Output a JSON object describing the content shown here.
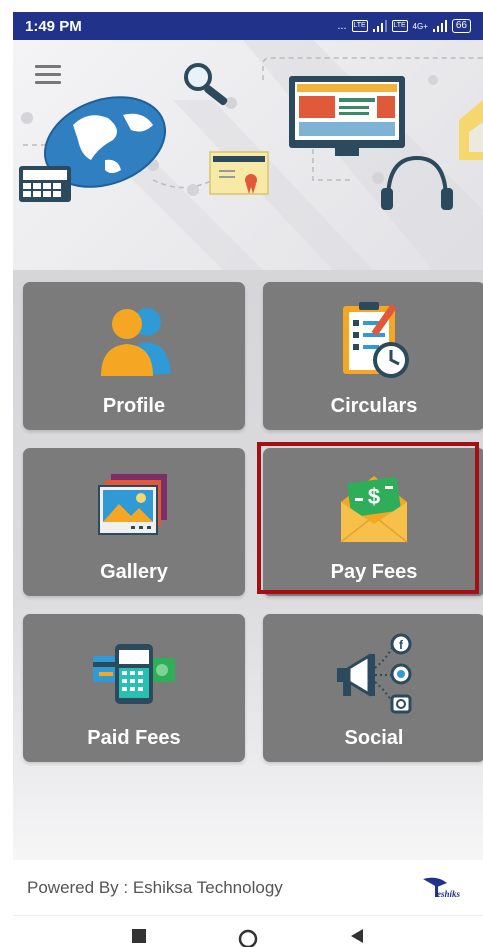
{
  "status_bar": {
    "time": "1:49 PM",
    "dots": "...",
    "sim1": "VoLTE",
    "sim2": "VoLTE",
    "network": "4G+",
    "battery": "66"
  },
  "menu": {
    "icon": "hamburger-menu-icon"
  },
  "tiles": [
    {
      "label": "Profile",
      "icon": "profile-users-icon"
    },
    {
      "label": "Circulars",
      "icon": "circulars-checklist-icon"
    },
    {
      "label": "Gallery",
      "icon": "gallery-photos-icon"
    },
    {
      "label": "Pay Fees",
      "icon": "pay-fees-envelope-icon",
      "highlighted": true
    },
    {
      "label": "Paid Fees",
      "icon": "paid-fees-card-icon"
    },
    {
      "label": "Social",
      "icon": "social-megaphone-icon"
    }
  ],
  "footer": {
    "powered_by": "Powered By : Eshiksa Technology",
    "logo_text": "eshiks"
  },
  "nav": {
    "recents": "recents-icon",
    "home": "home-icon",
    "back": "back-icon"
  },
  "colors": {
    "status_bar": "#21328a",
    "tile": "#7b7b7b",
    "highlight": "#a50f14"
  }
}
